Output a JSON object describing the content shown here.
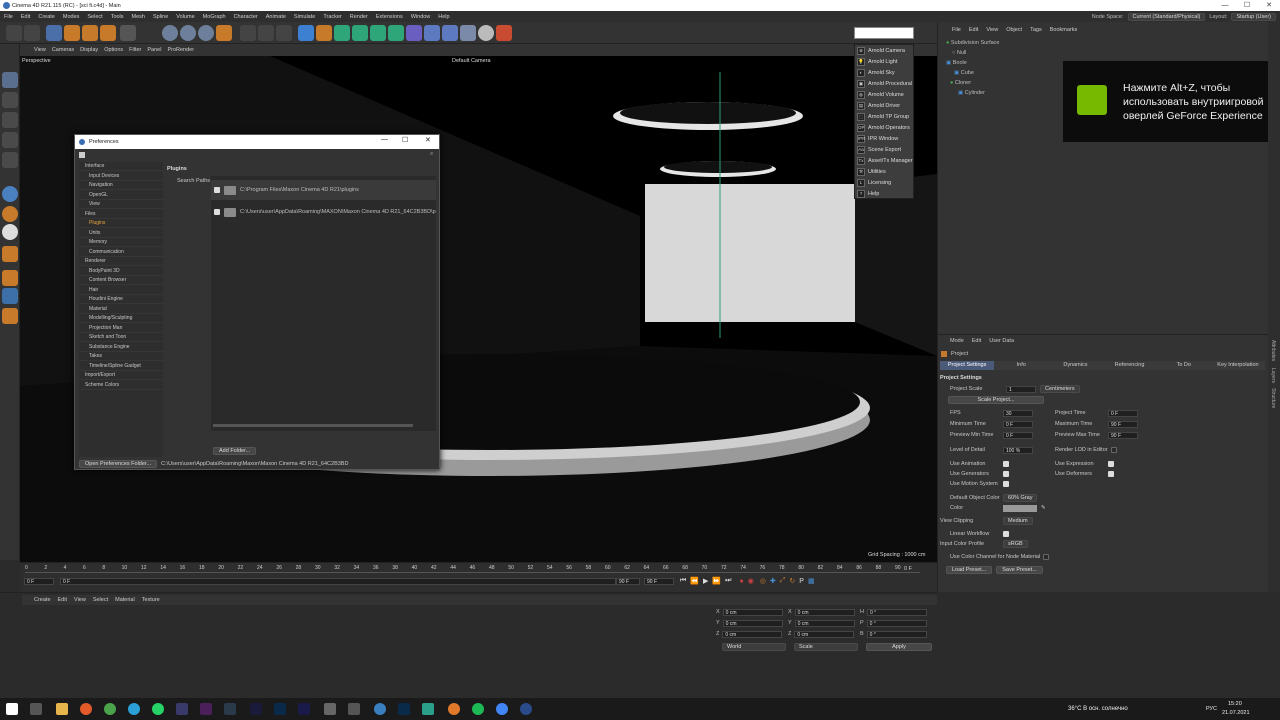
{
  "window": {
    "title": "Cinema 4D R21.115 (RC) - [sci fi.c4d] - Main",
    "min": "—",
    "max": "☐",
    "close": "✕"
  },
  "menu": [
    "File",
    "Edit",
    "Create",
    "Modes",
    "Select",
    "Tools",
    "Mesh",
    "Spline",
    "Volume",
    "MoGraph",
    "Character",
    "Animate",
    "Simulate",
    "Tracker",
    "Render",
    "Extensions",
    "Window",
    "Help"
  ],
  "node_space": {
    "label": "Node Space:",
    "value": "Current (Standard/Physical)"
  },
  "layout": {
    "label": "Layout:",
    "value": "Startup (User)"
  },
  "viewport_menu": [
    "View",
    "Cameras",
    "Display",
    "Options",
    "Filter",
    "Panel",
    "ProRender"
  ],
  "viewport": {
    "name": "Perspective",
    "camera": "Default Camera",
    "grid": "Grid Spacing : 1000 cm"
  },
  "object_menu": [
    "File",
    "Edit",
    "View",
    "Object",
    "Tags",
    "Bookmarks"
  ],
  "objects": [
    "Subdivision Surface",
    "Null",
    "Boole",
    "Cube",
    "Cloner",
    "Cylinder"
  ],
  "arnold_menu": [
    "Arnold Camera",
    "Arnold Light",
    "Arnold Sky",
    "Arnold Procedural",
    "Arnold Volume",
    "Arnold Driver",
    "Arnold TP Group",
    "Arnold Operators",
    "IPR Window",
    "Scene Export",
    "Asset/Tx Manager",
    "Utilities",
    "Licensing",
    "Help"
  ],
  "arnold_icons": [
    "⊕",
    "💡",
    "◐",
    "▣",
    "◍",
    "▤",
    "⬚",
    "OP",
    "IPR",
    "Aa",
    "Tx",
    "⚒",
    "L",
    "?"
  ],
  "nvidia_overlay": "Нажмите Alt+Z, чтобы использовать внутриигровой оверлей GeForce Experience",
  "attr_menu": [
    "Mode",
    "Edit",
    "User Data"
  ],
  "attr_title": "Project",
  "attr_tabs": [
    "Project Settings",
    "Info",
    "Dynamics",
    "Referencing",
    "To Do",
    "Key Interpolation"
  ],
  "attr_section": "Project Settings",
  "project_scale": {
    "label": "Project Scale",
    "value": "1",
    "unit": "Centimeters"
  },
  "scale_project_btn": "Scale Project...",
  "fields": {
    "fps": {
      "label": "FPS",
      "value": "30"
    },
    "project_time": {
      "label": "Project Time",
      "value": "0 F"
    },
    "min_time": {
      "label": "Minimum Time",
      "value": "0 F"
    },
    "max_time": {
      "label": "Maximum Time",
      "value": "90 F"
    },
    "prev_min": {
      "label": "Preview Min Time",
      "value": "0 F"
    },
    "prev_max": {
      "label": "Preview Max Time",
      "value": "90 F"
    },
    "lod": {
      "label": "Level of Detail",
      "value": "100 %"
    },
    "render_lod": {
      "label": "Render LOD in Editor"
    },
    "use_animation": {
      "label": "Use Animation"
    },
    "use_expression": {
      "label": "Use Expression"
    },
    "use_generators": {
      "label": "Use Generators"
    },
    "use_deformers": {
      "label": "Use Deformers"
    },
    "use_motion": {
      "label": "Use Motion System"
    },
    "default_color": {
      "label": "Default Object Color",
      "value": "60% Gray"
    },
    "color": {
      "label": "Color"
    },
    "view_clipping": {
      "label": "View Clipping",
      "value": "Medium"
    },
    "linear_workflow": {
      "label": "Linear Workflow"
    },
    "input_profile": {
      "label": "Input Color Profile",
      "value": "sRGB"
    },
    "node_material": {
      "label": "Use Color Channel for Node Material"
    }
  },
  "load_preset": "Load Preset...",
  "save_preset": "Save Preset...",
  "side_tabs": [
    "Attributes",
    "Layers",
    "Structure"
  ],
  "timeline_ticks": [
    "0",
    "2",
    "4",
    "6",
    "8",
    "10",
    "12",
    "14",
    "16",
    "18",
    "20",
    "22",
    "24",
    "26",
    "28",
    "30",
    "32",
    "34",
    "36",
    "38",
    "40",
    "42",
    "44",
    "46",
    "48",
    "50",
    "52",
    "54",
    "56",
    "58",
    "60",
    "62",
    "64",
    "66",
    "68",
    "70",
    "72",
    "74",
    "76",
    "78",
    "80",
    "82",
    "84",
    "86",
    "88",
    "90"
  ],
  "timeline_frame": "0 F",
  "timeline": {
    "start": "0 F",
    "current": "0 F",
    "end1": "90 F",
    "end2": "90 F"
  },
  "material_menu": [
    "Create",
    "Edit",
    "View",
    "Select",
    "Material",
    "Texture"
  ],
  "coords": {
    "x": "X",
    "y": "Y",
    "z": "Z",
    "h": "H",
    "p": "P",
    "b": "B",
    "zero": "0 cm",
    "zerodeg": "0 °",
    "world": "World",
    "scale": "Scale",
    "apply": "Apply"
  },
  "preferences": {
    "title": "Preferences",
    "nav": [
      "Interface",
      "Input Devices",
      "Navigation",
      "OpenGL",
      "View",
      "Files",
      "Plugins",
      "Units",
      "Memory",
      "Communication",
      "Renderer",
      "BodyPaint 3D",
      "Content Browser",
      "Hair",
      "Houdini Engine",
      "Material",
      "Modelling/Sculpting",
      "Projection Man",
      "Sketch and Toon",
      "Substance Engine",
      "Takes",
      "Timeline/Spline Gadget",
      "Import/Export",
      "Scheme Colors"
    ],
    "section": "Plugins",
    "search_paths": "Search Paths",
    "paths": [
      "C:\\Program Files\\Maxon Cinema 4D R21\\plugins",
      "C:\\Users\\user\\AppData\\Roaming\\MAXON\\Maxon Cinema 4D R21_64C2B3BD\\p"
    ],
    "add_folder": "Add Folder...",
    "open_folder": "Open Preferences Folder...",
    "folder_path": "C:\\Users\\user\\AppData\\Roaming\\Maxon\\Maxon Cinema 4D R21_64C2B3BD"
  },
  "taskbar": {
    "weather": "36°C  В осн. солнечно",
    "lang": "РУС",
    "time": "15:20",
    "date": "21.07.2021"
  }
}
